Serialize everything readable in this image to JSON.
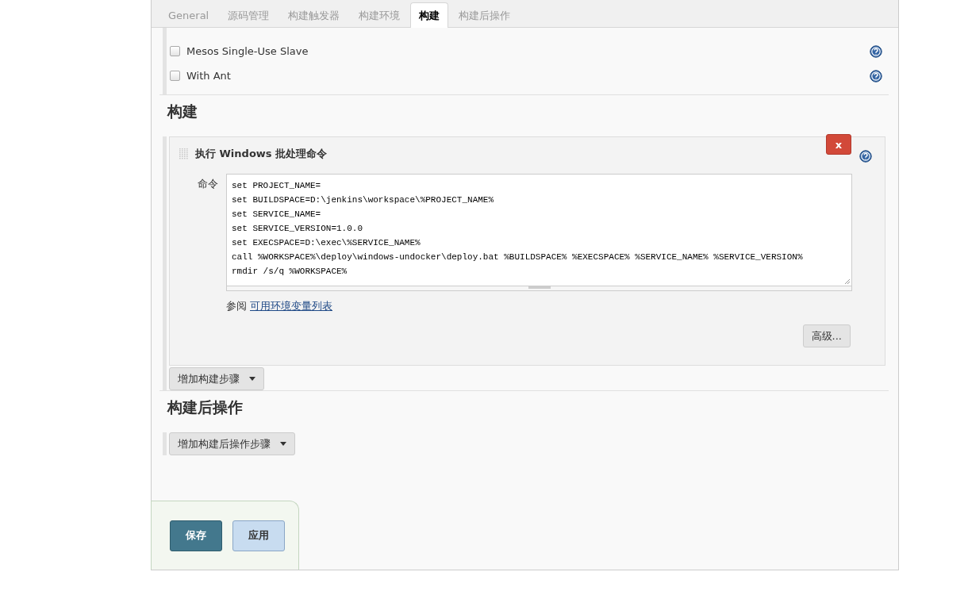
{
  "tabs": [
    {
      "label": "General",
      "selected": false
    },
    {
      "label": "源码管理",
      "selected": false
    },
    {
      "label": "构建触发器",
      "selected": false
    },
    {
      "label": "构建环境",
      "selected": false
    },
    {
      "label": "构建",
      "selected": true
    },
    {
      "label": "构建后操作",
      "selected": false
    }
  ],
  "options": [
    {
      "label": "Mesos Single-Use Slave",
      "checked": false
    },
    {
      "label": "With Ant",
      "checked": false
    }
  ],
  "build": {
    "heading": "构建",
    "step": {
      "title": "执行 Windows 批处理命令",
      "delete": "x",
      "field_label": "命令",
      "command_lines": [
        "set PROJECT_NAME=",
        "set BUILDSPACE=D:\\jenkins\\workspace\\%PROJECT_NAME%",
        "set SERVICE_NAME=",
        "set SERVICE_VERSION=1.0.0",
        "set EXECSPACE=D:\\exec\\%SERVICE_NAME%",
        "call %WORKSPACE%\\deploy\\windows-undocker\\deploy.bat %BUILDSPACE% %EXECSPACE% %SERVICE_NAME% %SERVICE_VERSION%",
        "rmdir /s/q %WORKSPACE%"
      ],
      "see_also": "参阅",
      "link": "可用环境变量列表",
      "advanced": "高级..."
    },
    "add_button": "增加构建步骤"
  },
  "post_build": {
    "heading": "构建后操作",
    "add_button": "增加构建后操作步骤"
  },
  "footer": {
    "save": "保存",
    "apply": "应用"
  }
}
